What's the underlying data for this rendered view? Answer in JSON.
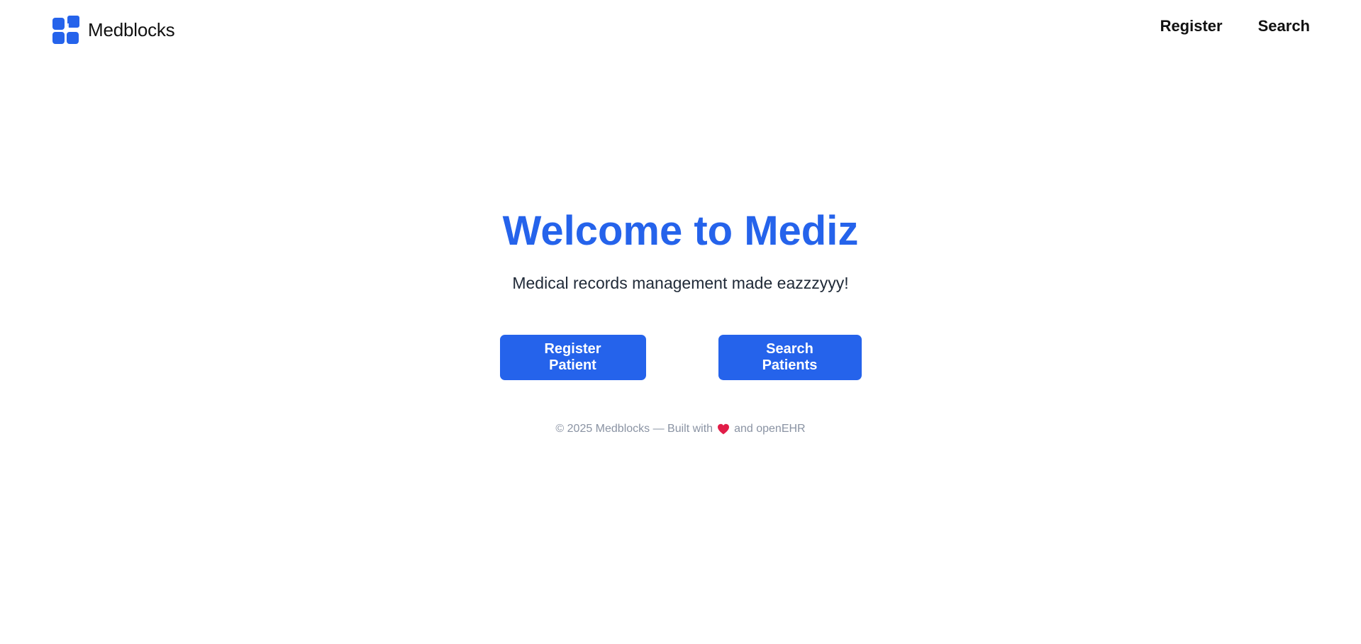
{
  "header": {
    "brand_name": "Medblocks",
    "brand_icon": "medblocks-logo-icon",
    "nav": {
      "register": "Register",
      "search": "Search"
    }
  },
  "hero": {
    "title": "Welcome to Mediz",
    "subtitle": "Medical records management made eazzzyyy!"
  },
  "actions": {
    "register_label": "Register Patient",
    "search_label": "Search Patients"
  },
  "footer": {
    "prefix": "© 2025 Medblocks — Built with",
    "heart_icon": "heart-icon",
    "suffix": "and openEHR"
  },
  "colors": {
    "accent": "#2563eb",
    "heart": "#e11d48",
    "footer_text": "#8a93a3"
  }
}
